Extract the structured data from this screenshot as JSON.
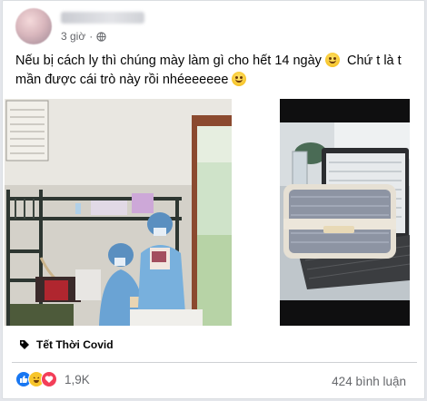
{
  "post": {
    "time": "3 giờ",
    "dot": "·",
    "text_line1": "Nếu bị cách ly thì chúng mày làm gì cho hết 14 ngày",
    "text_line1b": "  Chứ t là t",
    "text_line2": "mần được cái trò này rồi nhéeeeeee",
    "tag": "Tết Thời Covid",
    "reaction_count": "1,9K",
    "comments": "424 bình luận"
  },
  "icons": {
    "privacy": "globe-icon",
    "tag": "tag-icon",
    "reactions": [
      "like-icon",
      "haha-icon",
      "love-icon"
    ]
  },
  "colors": {
    "like": "#1877f2",
    "haha": "#f7c52b",
    "love": "#f33e58"
  }
}
